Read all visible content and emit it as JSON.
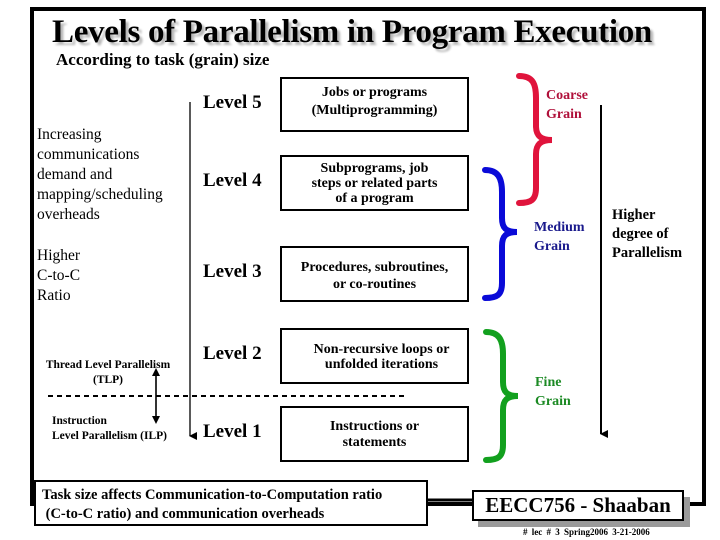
{
  "title": "Levels of Parallelism in Program Execution",
  "subtitle": "According to task (grain) size",
  "levels": [
    {
      "label": "Level 5",
      "box_lines": [
        "Jobs or programs",
        "(Multiprogramming)"
      ]
    },
    {
      "label": "Level 4",
      "box_lines": [
        "Subprograms, job",
        "steps or related parts",
        "of a program"
      ]
    },
    {
      "label": "Level 3",
      "box_lines": [
        "Procedures, subroutines,",
        "or co-routines"
      ]
    },
    {
      "label": "Level 2",
      "box_lines": [
        "Non-recursive loops or",
        "unfolded iterations"
      ]
    },
    {
      "label": "Level 1",
      "box_lines": [
        "Instructions or",
        "statements"
      ]
    }
  ],
  "left_notes": {
    "overheads": [
      "Increasing",
      "communications",
      "demand and",
      "mapping/scheduling",
      "overheads"
    ],
    "ctoc": [
      "Higher",
      "C-to-C",
      "Ratio"
    ],
    "tlp": [
      "Thread Level Parallelism",
      "(TLP)"
    ],
    "ilp": [
      "Instruction",
      "Level Parallelism (ILP)"
    ]
  },
  "grains": [
    {
      "name": "coarse",
      "lines": [
        "Coarse",
        "Grain"
      ],
      "color": "#e0143c"
    },
    {
      "name": "medium",
      "lines": [
        "Medium",
        "Grain"
      ],
      "color": "#0a0ad8"
    },
    {
      "name": "fine",
      "lines": [
        "Fine",
        "Grain"
      ],
      "color": "#12a01e"
    }
  ],
  "higher_degree": [
    "Higher",
    "degree of",
    "Parallelism"
  ],
  "note": [
    "Task size affects Communication-to-Computation ratio",
    " (C-to-C ratio) and communication overheads"
  ],
  "footer": {
    "course": "EECC756 - Shaaban",
    "meta": "#  lec # 3   Spring2006   3-21-2006"
  },
  "colors": {
    "coarse": "#e0143c",
    "medium": "#0a0ad8",
    "fine": "#12a01e",
    "medium_text": "#1a1a8c",
    "coarse_text": "#b0103a",
    "fine_text": "#1c8a24"
  }
}
